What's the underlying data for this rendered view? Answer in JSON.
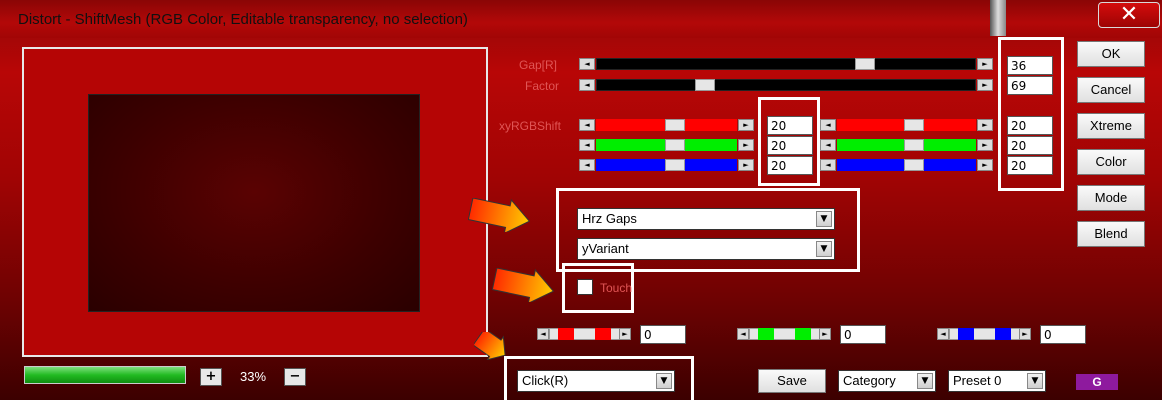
{
  "window": {
    "title": "Distort - ShiftMesh (RGB Color, Editable transparency, no selection)",
    "close_glyph": "✕"
  },
  "sliders": {
    "gap": {
      "label": "Gap[R]",
      "value": "36"
    },
    "factor": {
      "label": "Factor",
      "value": "69"
    },
    "xyrgb_label": "xyRGBShift",
    "red_x": "20",
    "green_x": "20",
    "blue_x": "20",
    "red_y": "20",
    "green_y": "20",
    "blue_y": "20"
  },
  "dropdowns": {
    "mode1": "Hrz Gaps",
    "mode2": "yVariant",
    "click": "Click(R)",
    "category": "Category",
    "preset": "Preset 0"
  },
  "checkbox": {
    "label": "Touch",
    "checked": false
  },
  "small_sliders": {
    "red": "0",
    "green": "0",
    "blue": "0"
  },
  "zoom": {
    "value": "33%",
    "plus": "+",
    "minus": "−"
  },
  "buttons": {
    "ok": "OK",
    "cancel": "Cancel",
    "xtreme": "Xtreme",
    "color": "Color",
    "mode": "Mode",
    "blend": "Blend",
    "save": "Save"
  },
  "logo": "G",
  "colors": {
    "accent_red": "#ff0000",
    "accent_green": "#00ee00",
    "accent_blue": "#0000ff",
    "progress": "#22bb22",
    "logo": "#8e1a9e"
  },
  "icons": {
    "scroll_left": "◄",
    "scroll_right": "►",
    "dropdown": "▼"
  }
}
